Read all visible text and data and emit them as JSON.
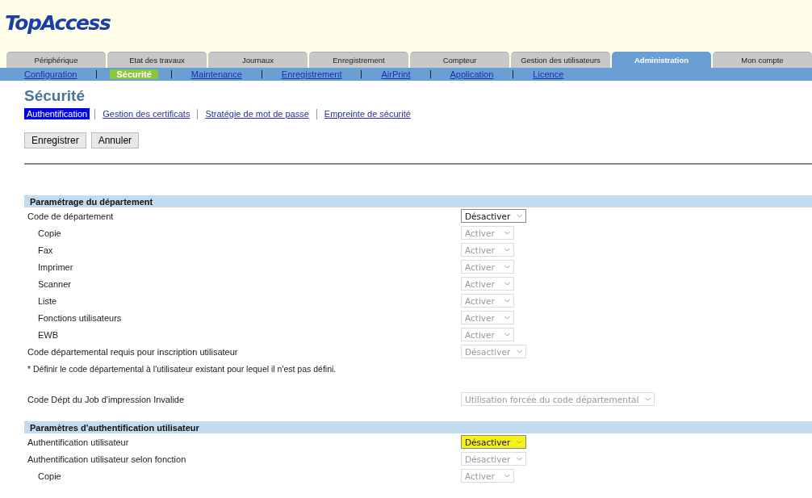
{
  "logo": "TopAccess",
  "tabs": [
    {
      "label": "Périphérique",
      "selected": false
    },
    {
      "label": "Etat des travaux",
      "selected": false
    },
    {
      "label": "Journaux",
      "selected": false
    },
    {
      "label": "Enregistrement",
      "selected": false
    },
    {
      "label": "Compteur",
      "selected": false
    },
    {
      "label": "Gestion des utilisateurs",
      "selected": false
    },
    {
      "label": "Administration",
      "selected": true
    },
    {
      "label": "Mon compte",
      "selected": false
    }
  ],
  "subnav": [
    {
      "label": "Configuration",
      "selected": false
    },
    {
      "label": "Sécurité",
      "selected": true
    },
    {
      "label": "Maintenance",
      "selected": false
    },
    {
      "label": "Enregistrement",
      "selected": false
    },
    {
      "label": "AirPrint",
      "selected": false
    },
    {
      "label": "Application",
      "selected": false
    },
    {
      "label": "Licence",
      "selected": false
    }
  ],
  "page_title": "Sécurité",
  "subtabs": [
    {
      "label": "Authentification",
      "selected": true
    },
    {
      "label": "Gestion des certificats",
      "selected": false
    },
    {
      "label": "Stratégie de mot de passe",
      "selected": false
    },
    {
      "label": "Empreinte de sécurité",
      "selected": false
    }
  ],
  "buttons": [
    "Enregistrer",
    "Annuler"
  ],
  "sections": [
    {
      "title": "Paramétrage du département",
      "items": [
        {
          "kind": "setting",
          "label": "Code de département",
          "value": "Désactiver",
          "disabled": false,
          "highlighted": false,
          "children": [
            {
              "kind": "setting",
              "label": "Copie",
              "value": "Activer",
              "disabled": true,
              "highlighted": false
            },
            {
              "kind": "setting",
              "label": "Fax",
              "value": "Activer",
              "disabled": true,
              "highlighted": false
            },
            {
              "kind": "setting",
              "label": "Imprimer",
              "value": "Activer",
              "disabled": true,
              "highlighted": false
            },
            {
              "kind": "setting",
              "label": "Scanner",
              "value": "Activer",
              "disabled": true,
              "highlighted": false
            },
            {
              "kind": "setting",
              "label": "Liste",
              "value": "Activer",
              "disabled": true,
              "highlighted": false
            },
            {
              "kind": "setting",
              "label": "Fonctions utilisateurs",
              "value": "Activer",
              "disabled": true,
              "highlighted": false
            },
            {
              "kind": "setting",
              "label": "EWB",
              "value": "Activer",
              "disabled": true,
              "highlighted": false
            }
          ]
        },
        {
          "kind": "setting",
          "label": "Code départemental requis pour inscription utilisateur",
          "value": "Désactiver",
          "disabled": true,
          "highlighted": false
        },
        {
          "kind": "note",
          "label": "* Définir le code départemental à l'utilisateur existant pour lequel il n'est pas défini."
        },
        {
          "kind": "spacer"
        },
        {
          "kind": "setting",
          "label": "Code Dépt du Job d'impression Invalide",
          "value": "Utilisation forcée du code départemental",
          "disabled": true,
          "highlighted": false
        },
        {
          "kind": "spacer"
        }
      ]
    },
    {
      "title": "Paramètres d'authentification utilisateur",
      "items": [
        {
          "kind": "setting",
          "label": "Authentification utilisateur",
          "value": "Désactiver",
          "disabled": false,
          "highlighted": true
        },
        {
          "kind": "setting",
          "label": "Authentification utilisateur selon fonction",
          "value": "Désactiver",
          "disabled": true,
          "highlighted": false,
          "children": [
            {
              "kind": "setting",
              "label": "Copie",
              "value": "Activer",
              "disabled": true,
              "highlighted": false
            }
          ]
        }
      ]
    }
  ]
}
